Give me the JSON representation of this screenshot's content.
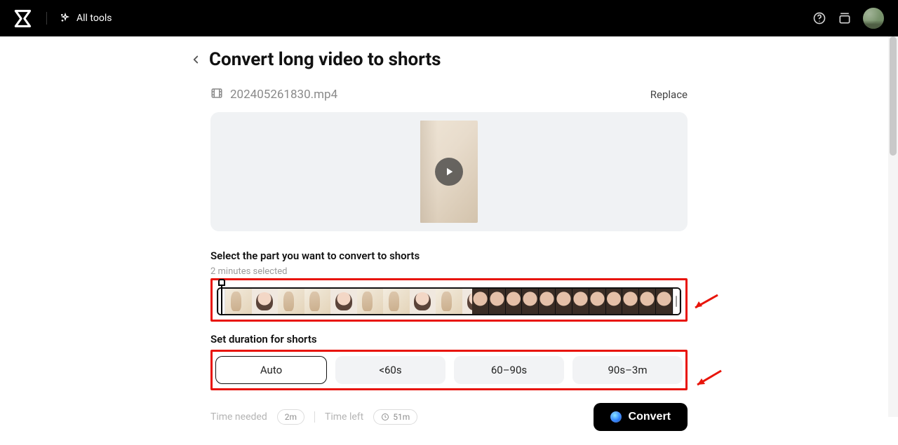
{
  "header": {
    "tools_label": "All tools"
  },
  "page": {
    "title": "Convert long video to shorts",
    "file_name": "202405261830.mp4",
    "replace_label": "Replace"
  },
  "selection": {
    "heading": "Select the part you want to convert to shorts",
    "selected_text": "2 minutes selected"
  },
  "duration": {
    "heading": "Set duration for shorts",
    "options": [
      "Auto",
      "<60s",
      "60–90s",
      "90s–3m"
    ],
    "active_index": 0
  },
  "footer": {
    "time_needed_label": "Time needed",
    "time_needed_value": "2m",
    "time_left_label": "Time left",
    "time_left_value": "51m",
    "convert_label": "Convert"
  }
}
